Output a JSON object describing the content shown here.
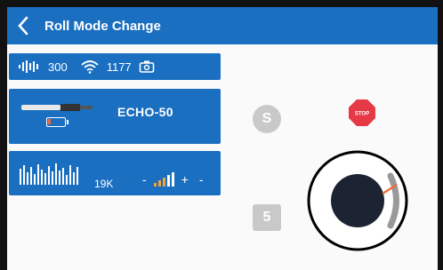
{
  "header": {
    "title": "Roll Mode Change"
  },
  "status": {
    "sonar_value": "300",
    "wifi_value": "1177"
  },
  "device": {
    "name": "ECHO-50",
    "battery_percent": 20
  },
  "sonar_settings": {
    "range": "19K",
    "minus_symbol": "-",
    "plus_symbol": "+",
    "gain_level": 0.5
  },
  "controls": {
    "round_button_label": "S",
    "square_button_label": "5",
    "stop_label": "STOP"
  },
  "colors": {
    "accent": "#1a6fc1",
    "stop_red": "#e53945",
    "battery_orange": "#f26a3a"
  },
  "icons": [
    "back-chevron-icon",
    "sonar-signal-icon",
    "wifi-icon",
    "camera-icon",
    "probe-icon",
    "battery-icon",
    "waveform-icon",
    "gain-bars-icon",
    "stop-sign-icon",
    "joystick-dial-icon"
  ]
}
